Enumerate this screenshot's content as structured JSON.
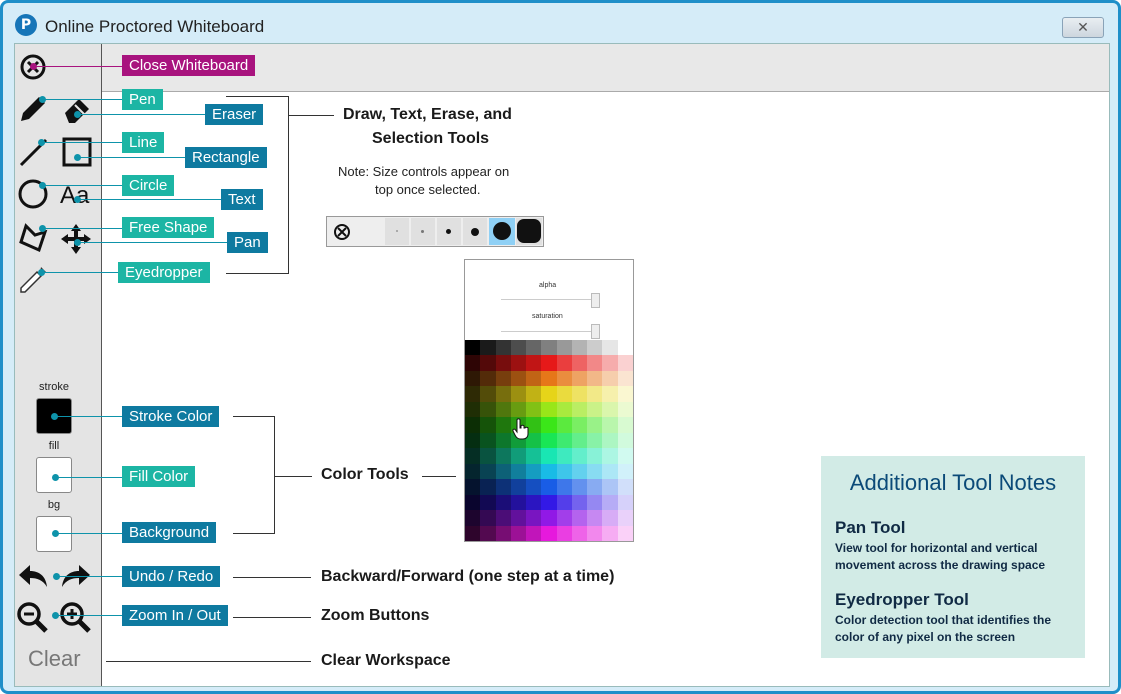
{
  "window": {
    "title": "Online Proctored Whiteboard",
    "logo": "P",
    "close_glyph": "✕"
  },
  "toolbar": {
    "stroke_label": "stroke",
    "fill_label": "fill",
    "bg_label": "bg",
    "clear_label": "Clear"
  },
  "callouts": {
    "close_whiteboard": "Close Whiteboard",
    "pen": "Pen",
    "eraser": "Eraser",
    "line": "Line",
    "rectangle": "Rectangle",
    "circle": "Circle",
    "text": "Text",
    "free_shape": "Free Shape",
    "pan": "Pan",
    "eyedropper": "Eyedropper",
    "stroke_color": "Stroke Color",
    "fill_color": "Fill Color",
    "background": "Background",
    "undo_redo": "Undo / Redo",
    "zoom": "Zoom In / Out"
  },
  "descriptions": {
    "draw_tools_1": "Draw, Text, Erase, and",
    "draw_tools_2": "Selection Tools",
    "size_note_1": "Note: Size controls appear on",
    "size_note_2": "top once selected.",
    "color_tools": "Color Tools",
    "backward_forward": "Backward/Forward (one step at a time)",
    "zoom_buttons": "Zoom Buttons",
    "clear_workspace": "Clear Workspace"
  },
  "picker": {
    "alpha_label": "alpha",
    "saturation_label": "saturation"
  },
  "notes": {
    "title": "Additional Tool Notes",
    "pan_title": "Pan Tool",
    "pan_body_1": "View tool for horizontal and vertical",
    "pan_body_2": "movement across the drawing space",
    "eyedropper_title": "Eyedropper Tool",
    "eyedropper_body_1": "Color detection tool that identifies the",
    "eyedropper_body_2": "color of any pixel on the screen"
  },
  "icons": [
    "close-circle-icon",
    "pen-icon",
    "eraser-icon",
    "line-icon",
    "rectangle-icon",
    "circle-icon",
    "text-aa-icon",
    "free-shape-icon",
    "pan-arrows-icon",
    "eyedropper-icon",
    "undo-icon",
    "redo-icon",
    "zoom-out-icon",
    "zoom-in-icon",
    "cursor-hand-icon"
  ],
  "colors": {
    "teal": "#1cb5a4",
    "blue": "#0e7aa0",
    "magenta": "#a8137e",
    "frame": "#1f8fc9",
    "notes_bg": "#d2ebe6",
    "notes_title": "#0b4a78"
  }
}
